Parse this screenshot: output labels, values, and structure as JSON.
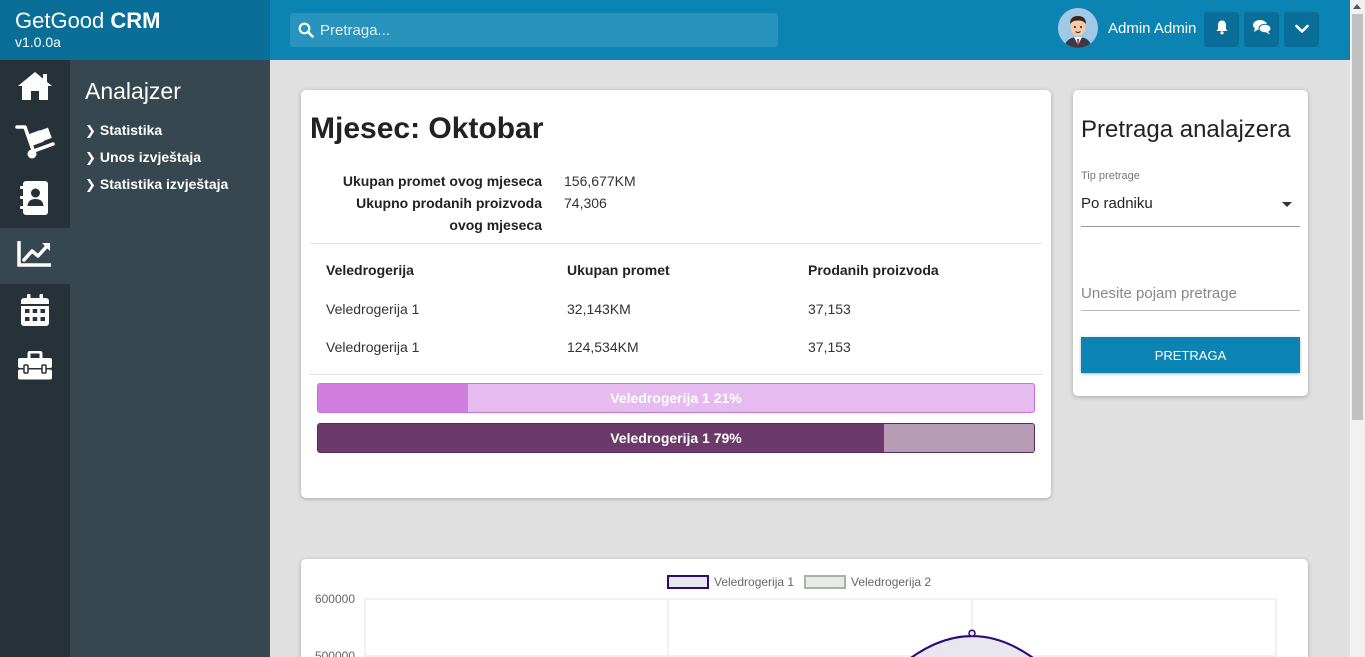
{
  "app": {
    "name": "GetGood",
    "name_bold": "CRM",
    "version": "v1.0.0a"
  },
  "search": {
    "placeholder": "Pretraga..."
  },
  "user": {
    "name": "Admin Admin"
  },
  "sidebar": {
    "icons": [
      "home-icon",
      "dolly-icon",
      "address-book-icon",
      "chart-line-icon",
      "calendar-icon",
      "toolbox-icon"
    ],
    "active_index": 3
  },
  "subnav": {
    "title": "Analajzer",
    "items": [
      {
        "label": "Statistika"
      },
      {
        "label": "Unos izvještaja"
      },
      {
        "label": "Statistika izvještaja"
      }
    ]
  },
  "month": {
    "title": "Mjesec: Oktobar",
    "summary": [
      {
        "label": "Ukupan promet ovog mjeseca",
        "value": "156,677KM"
      },
      {
        "label": "Ukupno prodanih proizvoda ovog mjeseca",
        "value": "74,306"
      }
    ],
    "table": {
      "headers": [
        "Veledrogerija",
        "Ukupan promet",
        "Prodanih proizvoda"
      ],
      "rows": [
        [
          "Veledrogerija 1",
          "32,143KM",
          "37,153"
        ],
        [
          "Veledrogerija 1",
          "124,534KM",
          "37,153"
        ]
      ]
    },
    "bars": [
      {
        "label": "Veledrogerija 1 21%",
        "percent": 21,
        "fill": "#d17ee0",
        "track": "#e6bbef",
        "border": "#c670d8"
      },
      {
        "label": "Veledrogerija 1 79%",
        "percent": 79,
        "fill": "#6b3a6a",
        "track": "#b59cb4",
        "border": "#5a2c58"
      }
    ]
  },
  "search_panel": {
    "title": "Pretraga analajzera",
    "type_label": "Tip pretrage",
    "type_value": "Po radniku",
    "term_placeholder": "Unesite pojam pretrage",
    "button": "PRETRAGA"
  },
  "chart_data": {
    "type": "line",
    "series": [
      {
        "name": "Veledrogerija 1",
        "color": "#2b0a73",
        "fill": "#e8e6ee"
      },
      {
        "name": "Veledrogerija 2",
        "color": "#a5b5a5",
        "fill": "#e6ebe6"
      }
    ],
    "y_ticks": [
      "600000",
      "500000"
    ],
    "visible_point": 540000,
    "grid": true,
    "legend": "top"
  },
  "colors": {
    "accent": "#0b84b3",
    "brand_bg": "#0a6f98",
    "sidebar": "#263238",
    "subnav": "#37474f"
  }
}
